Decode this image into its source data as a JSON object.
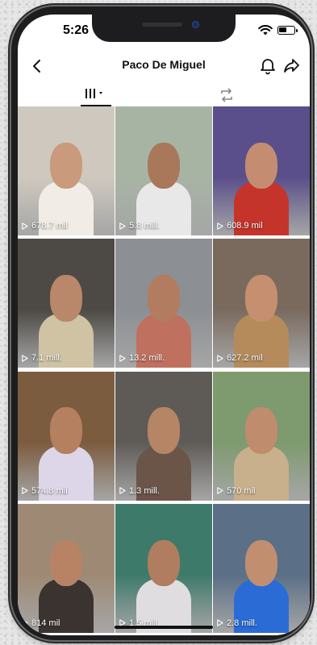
{
  "status_bar": {
    "time": "5:26"
  },
  "header": {
    "title": "Paco De Miguel"
  },
  "videos": [
    {
      "views": "678.7 mil",
      "bg": "#cfc8bf",
      "accent": "#f1ece6",
      "skin": "#c99a7c"
    },
    {
      "views": "5.8 mill.",
      "bg": "#a7b4a4",
      "accent": "#e8e8e8",
      "skin": "#a9775a"
    },
    {
      "views": "608.9 mil",
      "bg": "#5a4f8a",
      "accent": "#c5342b",
      "skin": "#c48c70"
    },
    {
      "views": "7.1 mill.",
      "bg": "#4d4a45",
      "accent": "#cfc3a4",
      "skin": "#b9876a"
    },
    {
      "views": "13.2 mill.",
      "bg": "#8c8f93",
      "accent": "#c0705e",
      "skin": "#b27c60"
    },
    {
      "views": "627.2 mil",
      "bg": "#7a6a5e",
      "accent": "#b58b5c",
      "skin": "#c69070"
    },
    {
      "views": "574.8 mil",
      "bg": "#7c5c3f",
      "accent": "#dcd6e8",
      "skin": "#b5805f"
    },
    {
      "views": "1.3 mill.",
      "bg": "#5e5b57",
      "accent": "#6b5448",
      "skin": "#b58566"
    },
    {
      "views": "570 mil",
      "bg": "#7e9a6f",
      "accent": "#c9b08c",
      "skin": "#c08c6e"
    },
    {
      "views": "814 mil",
      "bg": "#9e8a74",
      "accent": "#3a3330",
      "skin": "#b88365"
    },
    {
      "views": "1.5 mill.",
      "bg": "#3e7a6a",
      "accent": "#e0dde0",
      "skin": "#b07d61"
    },
    {
      "views": "2.8 mill.",
      "bg": "#5b6f86",
      "accent": "#2a6bd6",
      "skin": "#c18f70"
    }
  ]
}
